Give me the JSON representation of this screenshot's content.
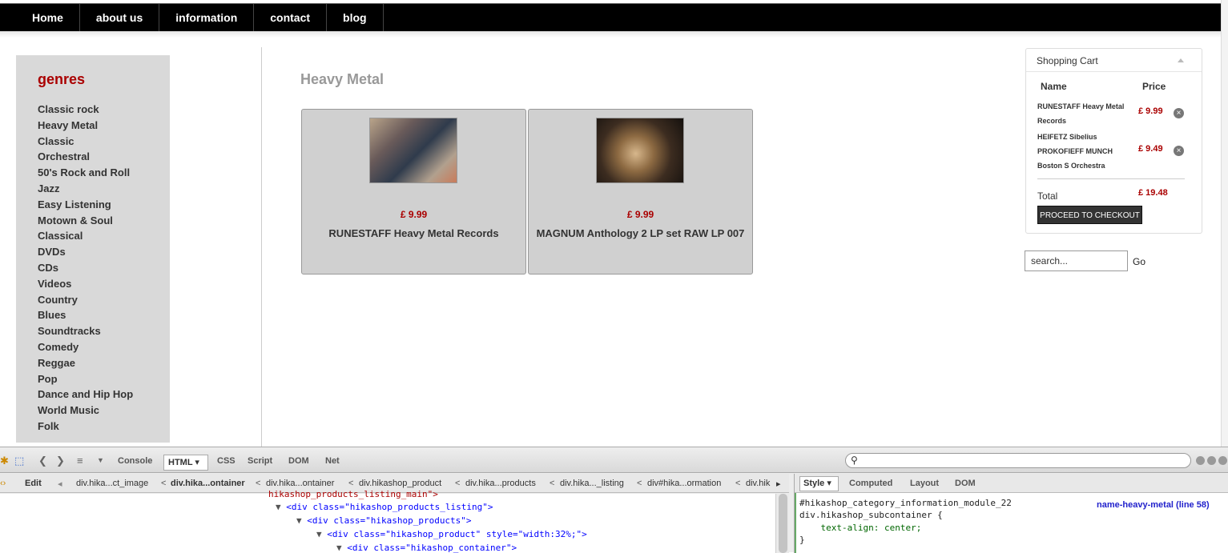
{
  "nav": {
    "items": [
      {
        "label": "Home"
      },
      {
        "label": "about us"
      },
      {
        "label": "information"
      },
      {
        "label": "contact"
      },
      {
        "label": "blog"
      }
    ]
  },
  "genres": {
    "title": "genres",
    "items": [
      "Classic rock",
      "Heavy Metal",
      "Classic",
      "Orchestral",
      "50's Rock and Roll",
      "Jazz",
      "Easy Listening",
      "Motown & Soul",
      "Classical",
      "DVDs",
      "CDs",
      "Videos",
      "Country",
      "Blues",
      "Soundtracks",
      "Comedy",
      "Reggae",
      "Pop",
      "Dance and Hip Hop",
      "World Music",
      "Folk"
    ]
  },
  "category": {
    "title": "Heavy Metal",
    "products": [
      {
        "price": "£ 9.99",
        "name": "RUNESTAFF Heavy Metal Records"
      },
      {
        "price": "£ 9.99",
        "name": "MAGNUM Anthology 2 LP set RAW LP 007"
      }
    ]
  },
  "cart": {
    "title": "Shopping Cart",
    "col_name": "Name",
    "col_price": "Price",
    "items": [
      {
        "line1": "RUNESTAFF Heavy Metal",
        "line2": "Records",
        "price": "£ 9.99"
      },
      {
        "line1": "HEIFETZ Sibelius",
        "line2": "PROKOFIEFF MUNCH",
        "line3": "Boston S Orchestra",
        "price": "£ 9.49"
      }
    ],
    "remove_symbol": "×",
    "total_label": "Total",
    "total": "£ 19.48",
    "checkout_label": "PROCEED TO CHECKOUT"
  },
  "search": {
    "value": "search...",
    "go_label": "Go"
  },
  "devtools": {
    "tabs": [
      "Console",
      "HTML",
      "CSS",
      "Script",
      "DOM",
      "Net"
    ],
    "html_tab_caret": "▾",
    "edit_label": "Edit",
    "breadcrumb": [
      "div.hika...ct_image",
      "div.hika...ontainer",
      "div.hika...ontainer",
      "div.hikashop_product",
      "div.hika...products",
      "div.hika..._listing",
      "div#hika...ormation",
      "div.hik"
    ],
    "code_lines": [
      "hikashop_products_listing_main\">",
      "<div class=\"hikashop_products_listing\">",
      "<div class=\"hikashop_products\">",
      "<div class=\"hikashop_product\" style=\"width:32%;\">",
      "<div class=\"hikashop_container\">"
    ],
    "side_tabs": [
      "Style",
      "Computed",
      "Layout",
      "DOM"
    ],
    "style_caret": "▾",
    "css_lines": [
      "#hikashop_category_information_module_22",
      "div.hikashop_subcontainer {",
      "    text-align: center;",
      "}"
    ],
    "css_source": "name-heavy-metal (line 58)"
  }
}
